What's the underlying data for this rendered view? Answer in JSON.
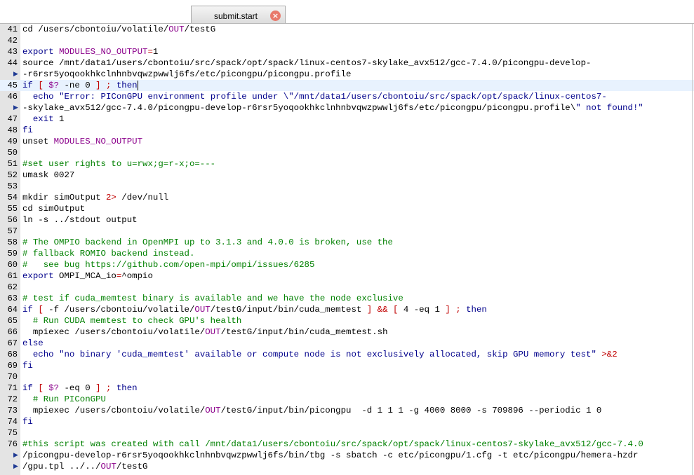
{
  "tab": {
    "title": "submit.start",
    "close_icon": "close-icon"
  },
  "lines": [
    {
      "ln": "41",
      "text": "cd /users/cbontoiu/volatile/OUT/testG"
    },
    {
      "ln": "42",
      "text": ""
    },
    {
      "ln": "43",
      "text": "export MODULES_NO_OUTPUT=1"
    },
    {
      "ln": "44",
      "text": "source /mnt/data1/users/cbontoiu/src/spack/opt/spack/linux-centos7-skylake_avx512/gcc-7.4.0/picongpu-develop-"
    },
    {
      "ln": "",
      "wrap": true,
      "text": "-r6rsr5yoqookhkclnhnbvqwzpwwlj6fs/etc/picongpu/picongpu.profile"
    },
    {
      "ln": "45",
      "text": "if [ $? -ne 0 ] ; then",
      "current": true
    },
    {
      "ln": "46",
      "text": "  echo \"Error: PIConGPU environment profile under \\\"/mnt/data1/users/cbontoiu/src/spack/opt/spack/linux-centos7-"
    },
    {
      "ln": "",
      "wrap": true,
      "text": "-skylake_avx512/gcc-7.4.0/picongpu-develop-r6rsr5yoqookhkclnhnbvqwzpwwlj6fs/etc/picongpu/picongpu.profile\\\" not found!\""
    },
    {
      "ln": "47",
      "text": "  exit 1"
    },
    {
      "ln": "48",
      "text": "fi"
    },
    {
      "ln": "49",
      "text": "unset MODULES_NO_OUTPUT"
    },
    {
      "ln": "50",
      "text": ""
    },
    {
      "ln": "51",
      "text": "#set user rights to u=rwx;g=r-x;o=---"
    },
    {
      "ln": "52",
      "text": "umask 0027"
    },
    {
      "ln": "53",
      "text": ""
    },
    {
      "ln": "54",
      "text": "mkdir simOutput 2> /dev/null"
    },
    {
      "ln": "55",
      "text": "cd simOutput"
    },
    {
      "ln": "56",
      "text": "ln -s ../stdout output"
    },
    {
      "ln": "57",
      "text": ""
    },
    {
      "ln": "58",
      "text": "# The OMPIO backend in OpenMPI up to 3.1.3 and 4.0.0 is broken, use the"
    },
    {
      "ln": "59",
      "text": "# fallback ROMIO backend instead."
    },
    {
      "ln": "60",
      "text": "#   see bug https://github.com/open-mpi/ompi/issues/6285"
    },
    {
      "ln": "61",
      "text": "export OMPI_MCA_io=^ompio"
    },
    {
      "ln": "62",
      "text": ""
    },
    {
      "ln": "63",
      "text": "# test if cuda_memtest binary is available and we have the node exclusive"
    },
    {
      "ln": "64",
      "text": "if [ -f /users/cbontoiu/volatile/OUT/testG/input/bin/cuda_memtest ] && [ 4 -eq 1 ] ; then"
    },
    {
      "ln": "65",
      "text": "  # Run CUDA memtest to check GPU's health"
    },
    {
      "ln": "66",
      "text": "  mpiexec /users/cbontoiu/volatile/OUT/testG/input/bin/cuda_memtest.sh"
    },
    {
      "ln": "67",
      "text": "else"
    },
    {
      "ln": "68",
      "text": "  echo \"no binary 'cuda_memtest' available or compute node is not exclusively allocated, skip GPU memory test\" >&2"
    },
    {
      "ln": "69",
      "text": "fi"
    },
    {
      "ln": "70",
      "text": ""
    },
    {
      "ln": "71",
      "text": "if [ $? -eq 0 ] ; then"
    },
    {
      "ln": "72",
      "text": "  # Run PIConGPU"
    },
    {
      "ln": "73",
      "text": "  mpiexec /users/cbontoiu/volatile/OUT/testG/input/bin/picongpu  -d 1 1 1 -g 4000 8000 -s 709896 --periodic 1 0"
    },
    {
      "ln": "74",
      "text": "fi"
    },
    {
      "ln": "75",
      "text": ""
    },
    {
      "ln": "76",
      "text": "#this script was created with call /mnt/data1/users/cbontoiu/src/spack/opt/spack/linux-centos7-skylake_avx512/gcc-7.4.0"
    },
    {
      "ln": "",
      "wrap": true,
      "text": "/picongpu-develop-r6rsr5yoqookhkclnhnbvqwzpwwlj6fs/bin/tbg -s sbatch -c etc/picongpu/1.cfg -t etc/picongpu/hemera-hzdr"
    },
    {
      "ln": "",
      "wrap": true,
      "text": "/gpu.tpl ../../OUT/testG"
    }
  ]
}
